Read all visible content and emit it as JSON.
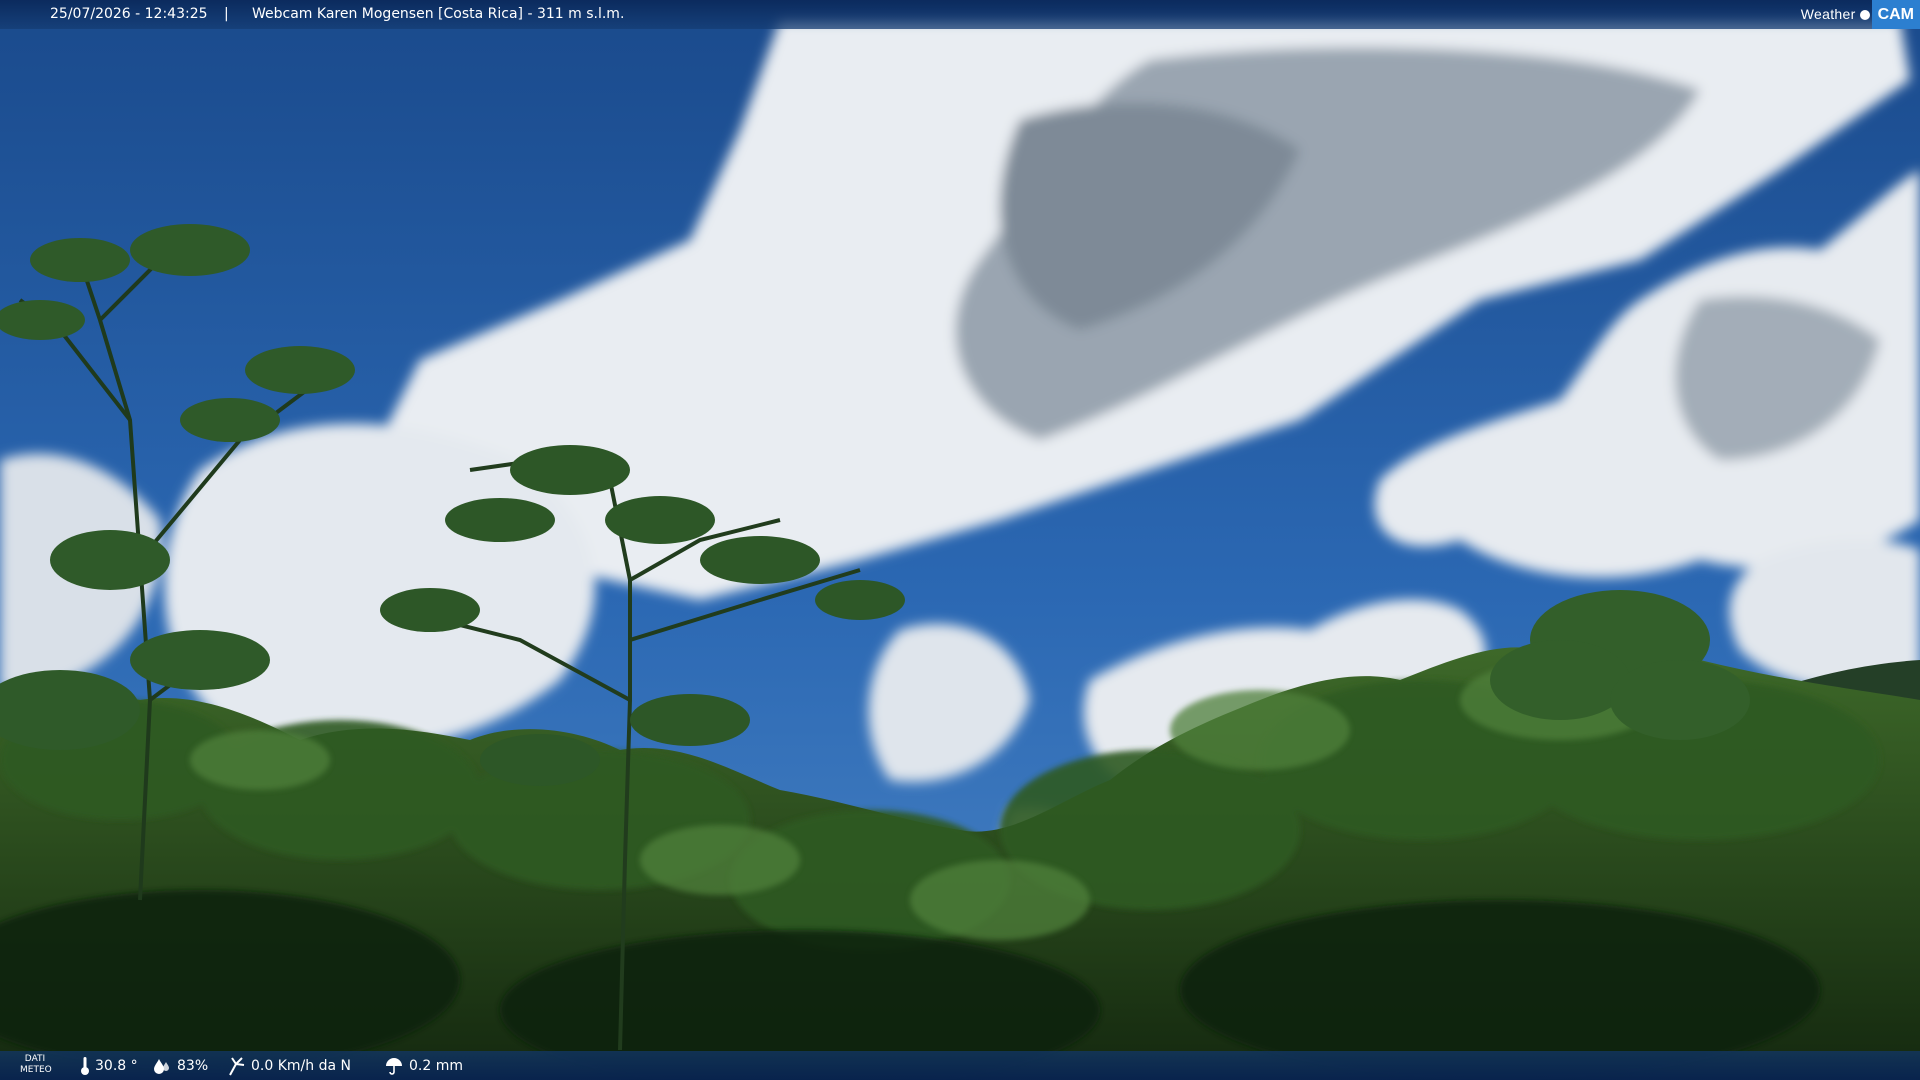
{
  "header": {
    "datetime": "25/07/2026 - 12:43:25",
    "separator": "|",
    "title": "Webcam Karen Mogensen [Costa Rica] - 311 m s.l.m.",
    "logo": {
      "text_weather": "Weather",
      "text_cam": "CAM",
      "accent_color": "#2c7fd0"
    }
  },
  "footer": {
    "label": [
      "DATI",
      "METEO"
    ],
    "temperature": {
      "value": "30.8 °",
      "icon": "thermometer-icon"
    },
    "humidity": {
      "value": "83%",
      "icon": "humidity-drop-icon"
    },
    "wind": {
      "value": "0.0 Km/h da N",
      "icon": "wind-icon"
    },
    "rain": {
      "value": "0.2 mm",
      "icon": "rain-umbrella-icon"
    }
  }
}
